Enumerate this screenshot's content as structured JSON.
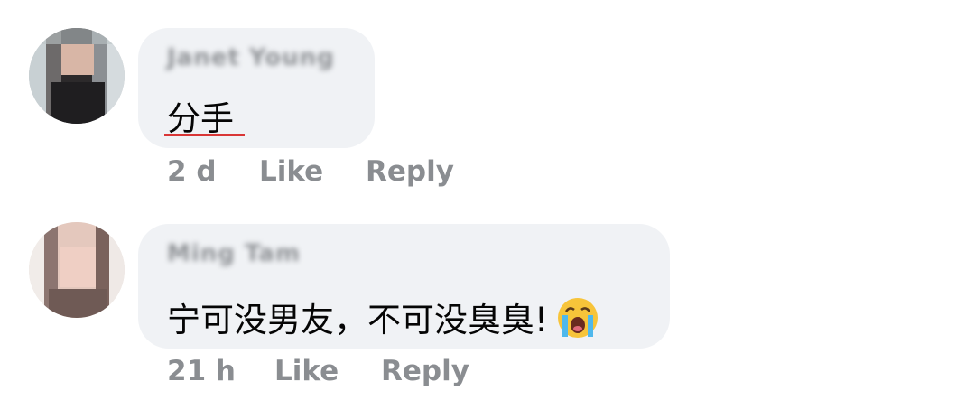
{
  "comments": [
    {
      "author": "Janet Young",
      "text": "分手",
      "time": "2 d",
      "like_label": "Like",
      "reply_label": "Reply"
    },
    {
      "author": "Ming Tam",
      "text": "宁可没男友，不可没臭臭!",
      "emoji": "crying-face-emoji",
      "time": "21 h",
      "like_label": "Like",
      "reply_label": "Reply"
    }
  ],
  "colors": {
    "bubble": "#f0f2f5",
    "action_text": "#8a8d91",
    "spellcheck_underline": "#d93636"
  }
}
